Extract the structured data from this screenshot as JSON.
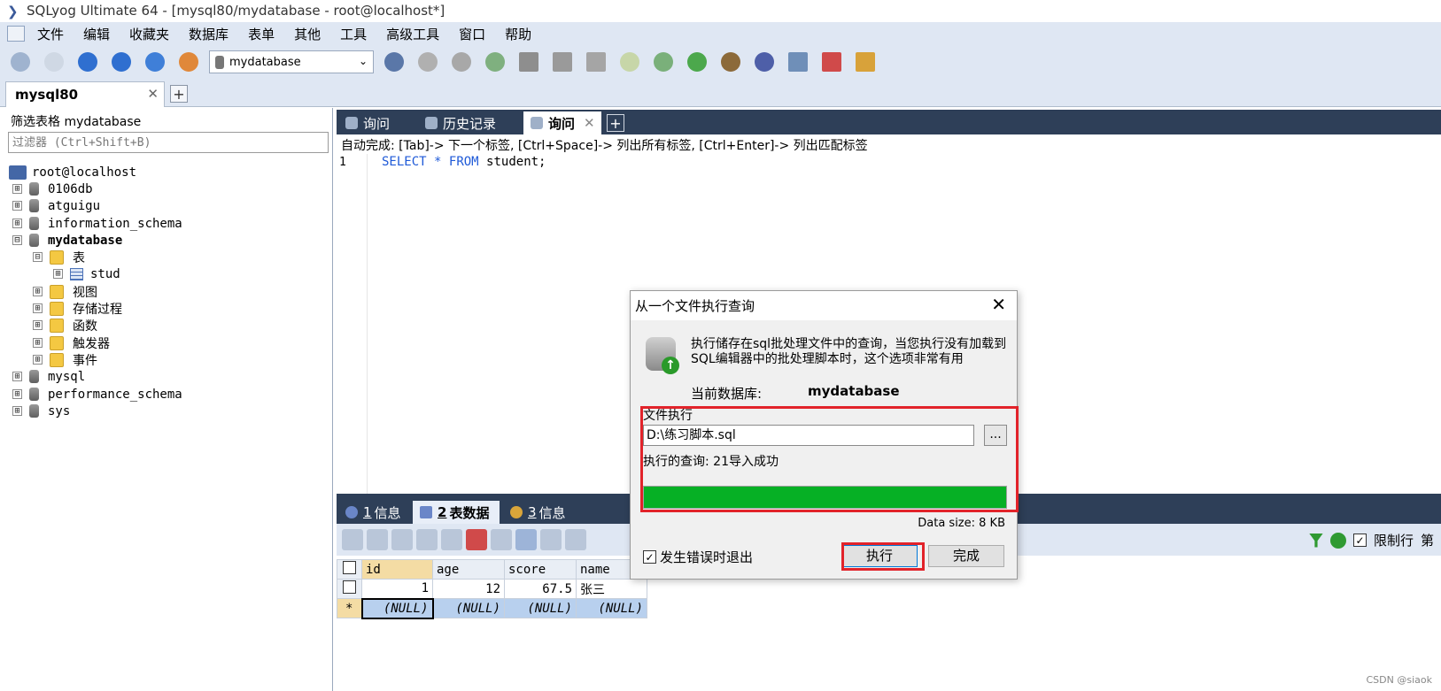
{
  "window": {
    "title": "SQLyog Ultimate 64 - [mysql80/mydatabase - root@localhost*]"
  },
  "menu": [
    "文件",
    "编辑",
    "收藏夹",
    "数据库",
    "表单",
    "其他",
    "工具",
    "高级工具",
    "窗口",
    "帮助"
  ],
  "toolbar": {
    "database_select": "mydatabase"
  },
  "connection_tab": {
    "label": "mysql80",
    "close": "✕",
    "add": "+"
  },
  "object_browser": {
    "filter_label": "筛选表格 mydatabase",
    "filter_placeholder": "过滤器 (Ctrl+Shift+B)",
    "root": "root@localhost",
    "databases": [
      "0106db",
      "atguigu",
      "information_schema",
      "mydatabase",
      "mysql",
      "performance_schema",
      "sys"
    ],
    "mydatabase_children": {
      "tables_folder": "表",
      "table": "stud",
      "folders": [
        "视图",
        "存储过程",
        "函数",
        "触发器",
        "事件"
      ]
    },
    "collapsed": "⊞",
    "expanded": "⊟"
  },
  "query_tabs": [
    {
      "label": "询问"
    },
    {
      "label": "历史记录"
    },
    {
      "label": "询问",
      "close": "✕"
    }
  ],
  "query_add": "+",
  "editor": {
    "hint": "自动完成: [Tab]-> 下一个标签, [Ctrl+Space]-> 列出所有标签, [Ctrl+Enter]-> 列出匹配标签",
    "line_number": "1",
    "sql": {
      "select": "SELECT",
      "star": "*",
      "from": "FROM",
      "rest": "student;"
    }
  },
  "result_tabs": [
    {
      "num": "1",
      "label": "信息"
    },
    {
      "num": "2",
      "label": "表数据"
    },
    {
      "num": "3",
      "label": "信息"
    }
  ],
  "result_toolbar": {
    "limit_label": "限制行",
    "first_label": "第"
  },
  "grid": {
    "columns": [
      "id",
      "age",
      "score",
      "name"
    ],
    "rows": [
      [
        "1",
        "12",
        "67.5",
        "张三"
      ]
    ],
    "new_row_marker": "*",
    "null_text": "(NULL)"
  },
  "dialog": {
    "title": "从一个文件执行查询",
    "close": "✕",
    "description": "执行储存在sql批处理文件中的查询，当您执行没有加载到SQL编辑器中的批处理脚本时，这个选项非常有用",
    "current_db_label": "当前数据库:",
    "current_db_value": "mydatabase",
    "file_group_label": "文件执行",
    "file_path": "D:\\练习脚本.sql",
    "browse_label": "...",
    "status": "执行的查询: 21导入成功",
    "progress": 1.0,
    "data_size": "Data size: 8 KB",
    "abort_on_error_label": "发生错误时退出",
    "abort_on_error_checked": true,
    "execute_label": "执行",
    "done_label": "完成"
  },
  "watermark": "CSDN @siaok",
  "colors": {
    "accent_red": "#e2232a",
    "progress_green": "#06b025",
    "tab_dark": "#2e3f58"
  }
}
